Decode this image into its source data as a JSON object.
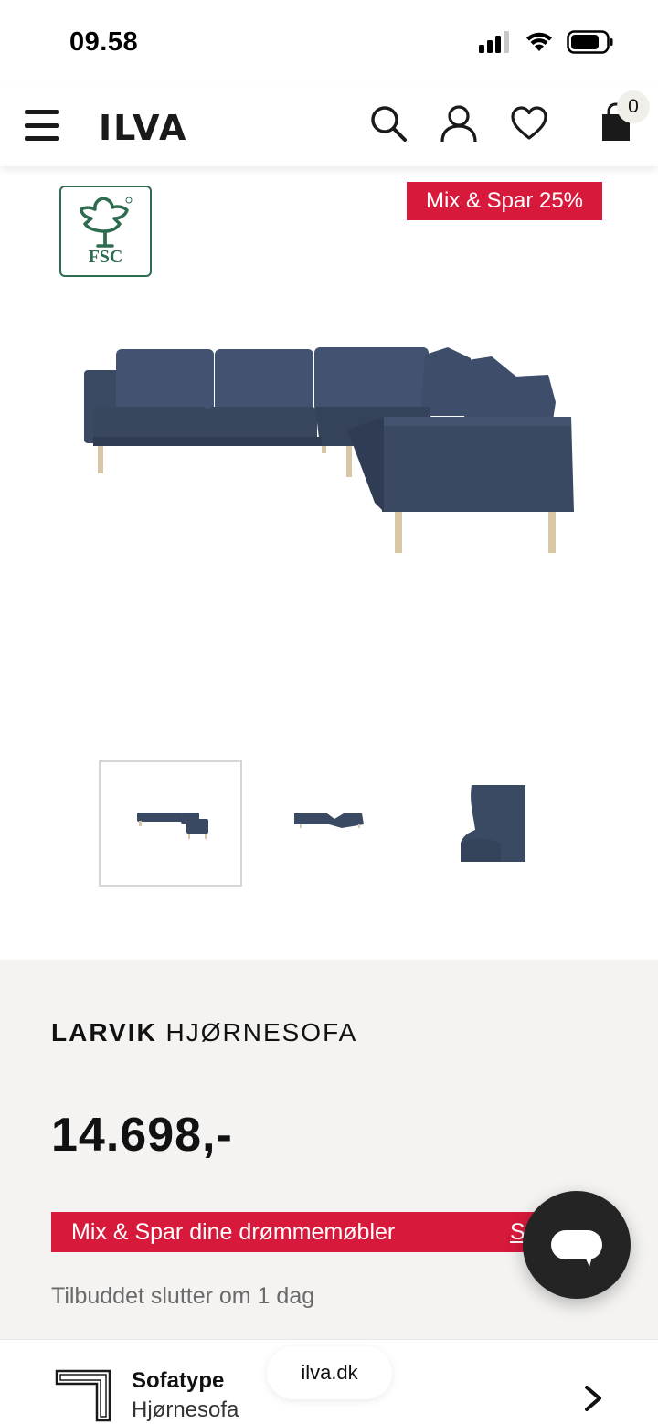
{
  "status_bar": {
    "time": "09.58"
  },
  "header": {
    "logo": "ILVA",
    "cart_count": "0"
  },
  "badges": {
    "fsc": "FSC",
    "promo": "Mix & Spar 25%"
  },
  "product": {
    "brand": "LARVIK",
    "name": "HJØRNESOFA",
    "price": "14.698,-",
    "mix_spar_text": "Mix & Spar dine drømmemøbler",
    "mix_spar_link": "S",
    "offer_ends": "Tilbuddet slutter om 1 dag"
  },
  "option": {
    "label": "Sofatype",
    "value": "Hjørnesofa"
  },
  "browser": {
    "url": "ilva.dk"
  },
  "colors": {
    "accent_red": "#d7193b",
    "fsc_green": "#2e6b4f",
    "sofa_blue": "#3b4a63",
    "info_bg": "#f4f3f1"
  }
}
